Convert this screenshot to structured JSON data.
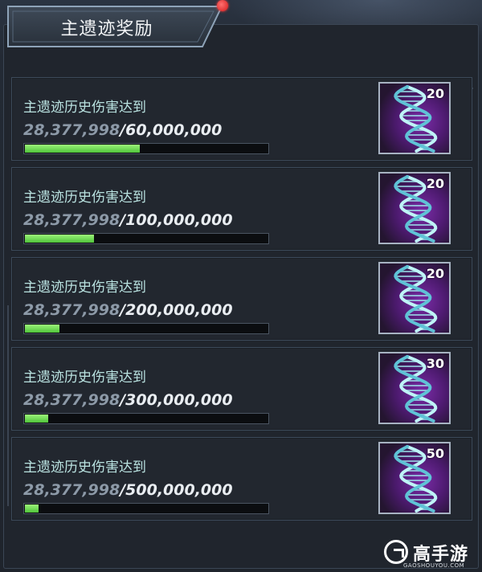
{
  "panel": {
    "title": "主遗迹奖励",
    "has_notification": true
  },
  "rewards": [
    {
      "label": "主遗迹历史伤害达到",
      "current": "28,377,998",
      "separator": "/",
      "target": "60,000,000",
      "progress": 0.473,
      "reward_icon": "dna-helix-icon",
      "count": "20"
    },
    {
      "label": "主遗迹历史伤害达到",
      "current": "28,377,998",
      "separator": "/",
      "target": "100,000,000",
      "progress": 0.284,
      "reward_icon": "dna-helix-icon",
      "count": "20"
    },
    {
      "label": "主遗迹历史伤害达到",
      "current": "28,377,998",
      "separator": "/",
      "target": "200,000,000",
      "progress": 0.142,
      "reward_icon": "dna-helix-icon",
      "count": "20"
    },
    {
      "label": "主遗迹历史伤害达到",
      "current": "28,377,998",
      "separator": "/",
      "target": "300,000,000",
      "progress": 0.095,
      "reward_icon": "dna-helix-icon",
      "count": "30"
    },
    {
      "label": "主遗迹历史伤害达到",
      "current": "28,377,998",
      "separator": "/",
      "target": "500,000,000",
      "progress": 0.057,
      "reward_icon": "dna-helix-icon",
      "count": "50"
    }
  ],
  "watermark": {
    "brand": "高手游",
    "url": "GAOSHOUYOU.COM"
  },
  "colors": {
    "accent_text": "#b9e2e0",
    "progress_fill": "#6fdc52",
    "notification": "#e02b2b",
    "reward_glow": "#7b2ca8"
  }
}
